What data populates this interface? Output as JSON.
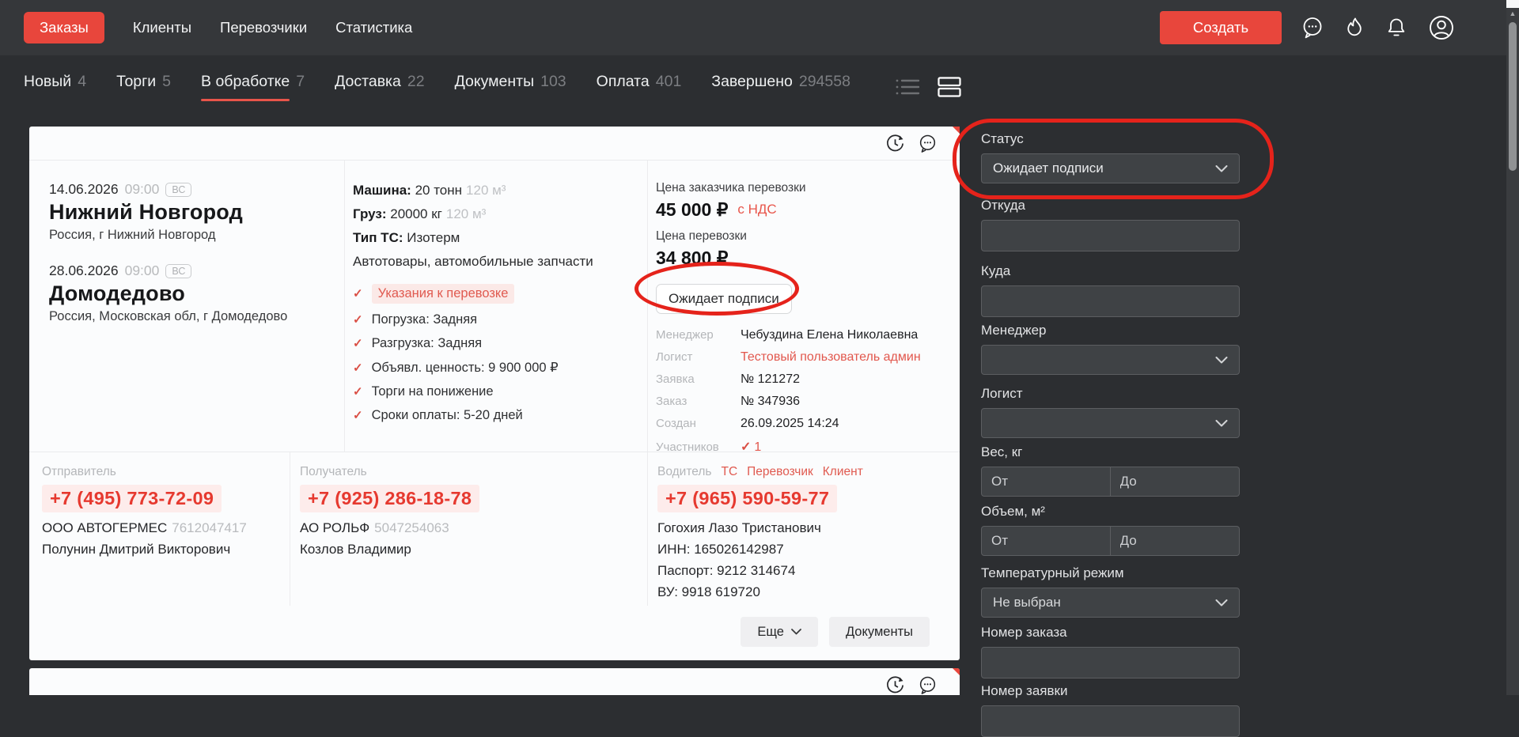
{
  "nav": {
    "items": [
      "Заказы",
      "Клиенты",
      "Перевозчики",
      "Статистика"
    ],
    "create_button": "Создать",
    "icons": [
      "chat-icon",
      "flame-icon",
      "bell-icon",
      "profile-icon"
    ]
  },
  "tabs": [
    {
      "label": "Новый",
      "count": "4"
    },
    {
      "label": "Торги",
      "count": "5"
    },
    {
      "label": "В обработке",
      "count": "7"
    },
    {
      "label": "Доставка",
      "count": "22"
    },
    {
      "label": "Документы",
      "count": "103"
    },
    {
      "label": "Оплата",
      "count": "401"
    },
    {
      "label": "Завершено",
      "count": "294558"
    }
  ],
  "view_toggles": [
    "list-view",
    "cards-view"
  ],
  "card": {
    "header_icons": [
      "history-icon",
      "chat-icon"
    ],
    "route": [
      {
        "date": "14.06.2026",
        "time": "09:00",
        "day": "ВС",
        "city": "Нижний Новгород",
        "address": "Россия, г Нижний Новгород"
      },
      {
        "date": "28.06.2026",
        "time": "09:00",
        "day": "ВС",
        "city": "Домодедово",
        "address": "Россия, Московская обл, г Домодедово"
      }
    ],
    "specs": [
      {
        "label": "Машина:",
        "value": "20 тонн",
        "extra": "120 м³"
      },
      {
        "label": "Груз:",
        "value": "20000 кг",
        "extra": "120 м³"
      },
      {
        "label": "Тип ТС:",
        "value": "Изотерм",
        "extra": ""
      }
    ],
    "cargo": "Автотовары, автомобильные запчасти",
    "checklist": [
      {
        "text": "Указания к перевозке"
      },
      {
        "text": "Погрузка: Задняя"
      },
      {
        "text": "Разгрузка: Задняя"
      },
      {
        "text": "Объявл. ценность: 9 900 000 ₽"
      },
      {
        "text": "Торги на понижение"
      },
      {
        "text": "Сроки оплаты: 5-20 дней"
      }
    ],
    "pricing": {
      "customer_label": "Цена заказчика перевозки",
      "customer_price": "45 000 ₽",
      "vat": "с НДС",
      "carrier_label": "Цена перевозки",
      "carrier_price": "34 800 ₽"
    },
    "status": "Ожидает подписи",
    "details": [
      {
        "label": "Менеджер",
        "value": "Чебуздина Елена Николаевна"
      },
      {
        "label": "Логист",
        "value": "Тестовый пользователь админ"
      },
      {
        "label": "Заявка",
        "value": "№ 121272"
      },
      {
        "label": "Заказ",
        "value": "№ 347936"
      },
      {
        "label": "Создан",
        "value": "26.09.2025 14:24"
      },
      {
        "label": "Участников",
        "value": "1"
      }
    ],
    "sender": {
      "label": "Отправитель",
      "phone": "+7 (495) 773-72-09",
      "company": "ООО АВТОГЕРМЕС",
      "company_id": "7612047417",
      "person": "Полунин Дмитрий Викторович"
    },
    "receiver": {
      "label": "Получатель",
      "phone": "+7 (925) 286-18-78",
      "company": "АО РОЛЬФ",
      "company_id": "5047254063",
      "person": "Козлов Владимир"
    },
    "driver": {
      "label": "Водитель",
      "links": [
        "ТС",
        "Перевозчик",
        "Клиент"
      ],
      "phone": "+7 (965) 590-59-77",
      "name": "Гогохия Лазо Тристанович",
      "inn": "ИНН: 165026142987",
      "passport": "Паспорт: 9212 314674",
      "license": "ВУ: 9918 619720"
    },
    "footer": {
      "more": "Еще",
      "documents": "Документы"
    }
  },
  "filters": {
    "status": {
      "label": "Статус",
      "value": "Ожидает подписи"
    },
    "from": {
      "label": "Откуда",
      "value": ""
    },
    "to": {
      "label": "Куда",
      "value": ""
    },
    "manager": {
      "label": "Менеджер",
      "value": ""
    },
    "logist": {
      "label": "Логист",
      "value": ""
    },
    "weight": {
      "label": "Вес, кг",
      "from_ph": "От",
      "to_ph": "До"
    },
    "volume": {
      "label": "Объем, м²",
      "from_ph": "От",
      "to_ph": "До"
    },
    "temperature": {
      "label": "Температурный режим",
      "value": "Не выбран"
    },
    "order_number": {
      "label": "Номер заказа",
      "value": ""
    },
    "request_number": {
      "label": "Номер заявки",
      "value": ""
    }
  },
  "colors": {
    "accent": "#e8463c",
    "annotation": "#e5231b",
    "phone_red": "#e6392f"
  }
}
